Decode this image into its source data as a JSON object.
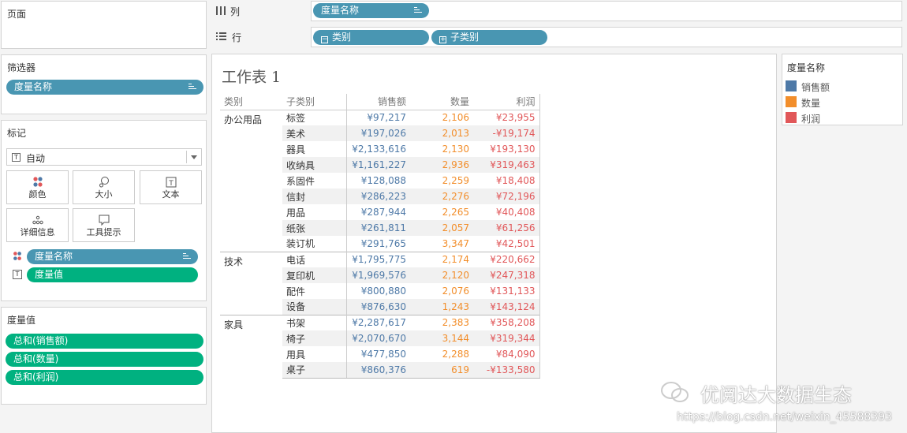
{
  "pages_card": {
    "title": "页面"
  },
  "filters_card": {
    "title": "筛选器",
    "pill": "度量名称"
  },
  "marks_card": {
    "title": "标记",
    "mark_type": "自动",
    "buttons": {
      "color": "颜色",
      "size": "大小",
      "text": "文本",
      "detail": "详细信息",
      "tooltip": "工具提示"
    },
    "fields": {
      "color_field": "度量名称",
      "text_field": "度量值"
    }
  },
  "measure_values_card": {
    "title": "度量值",
    "pills": [
      "总和(销售额)",
      "总和(数量)",
      "总和(利润)"
    ]
  },
  "shelves": {
    "columns": {
      "label": "列",
      "pill": "度量名称"
    },
    "rows": {
      "label": "行",
      "pills": [
        "类别",
        "子类别"
      ]
    }
  },
  "sheet": {
    "title": "工作表 1",
    "headers": {
      "category": "类别",
      "subcategory": "子类别",
      "sales": "销售额",
      "quantity": "数量",
      "profit": "利润"
    },
    "groups": [
      {
        "category": "办公用品",
        "rows": [
          {
            "sub": "标签",
            "sales": "¥97,217",
            "qty": "2,106",
            "profit": "¥23,955"
          },
          {
            "sub": "美术",
            "sales": "¥197,026",
            "qty": "2,013",
            "profit": "-¥19,174"
          },
          {
            "sub": "器具",
            "sales": "¥2,133,616",
            "qty": "2,130",
            "profit": "¥193,130"
          },
          {
            "sub": "收纳具",
            "sales": "¥1,161,227",
            "qty": "2,936",
            "profit": "¥319,463"
          },
          {
            "sub": "系固件",
            "sales": "¥128,088",
            "qty": "2,259",
            "profit": "¥18,408"
          },
          {
            "sub": "信封",
            "sales": "¥286,223",
            "qty": "2,276",
            "profit": "¥72,196"
          },
          {
            "sub": "用品",
            "sales": "¥287,944",
            "qty": "2,265",
            "profit": "¥40,408"
          },
          {
            "sub": "纸张",
            "sales": "¥261,811",
            "qty": "2,057",
            "profit": "¥61,256"
          },
          {
            "sub": "装订机",
            "sales": "¥291,765",
            "qty": "3,347",
            "profit": "¥42,501"
          }
        ]
      },
      {
        "category": "技术",
        "rows": [
          {
            "sub": "电话",
            "sales": "¥1,795,775",
            "qty": "2,174",
            "profit": "¥220,662"
          },
          {
            "sub": "复印机",
            "sales": "¥1,969,576",
            "qty": "2,120",
            "profit": "¥247,318"
          },
          {
            "sub": "配件",
            "sales": "¥800,880",
            "qty": "2,076",
            "profit": "¥131,133"
          },
          {
            "sub": "设备",
            "sales": "¥876,630",
            "qty": "1,243",
            "profit": "¥143,124"
          }
        ]
      },
      {
        "category": "家具",
        "rows": [
          {
            "sub": "书架",
            "sales": "¥2,287,617",
            "qty": "2,383",
            "profit": "¥358,208"
          },
          {
            "sub": "椅子",
            "sales": "¥2,070,670",
            "qty": "3,144",
            "profit": "¥319,344"
          },
          {
            "sub": "用具",
            "sales": "¥477,850",
            "qty": "2,288",
            "profit": "¥84,090"
          },
          {
            "sub": "桌子",
            "sales": "¥860,376",
            "qty": "619",
            "profit": "-¥133,580"
          }
        ]
      }
    ]
  },
  "legend": {
    "title": "度量名称",
    "items": [
      {
        "label": "销售额",
        "color": "#4e79a7"
      },
      {
        "label": "数量",
        "color": "#f28e2b"
      },
      {
        "label": "利润",
        "color": "#e15759"
      }
    ]
  },
  "watermark": {
    "brand": "优阅达大数据生态",
    "url": "https://blog.csdn.net/weixin_45588393"
  }
}
